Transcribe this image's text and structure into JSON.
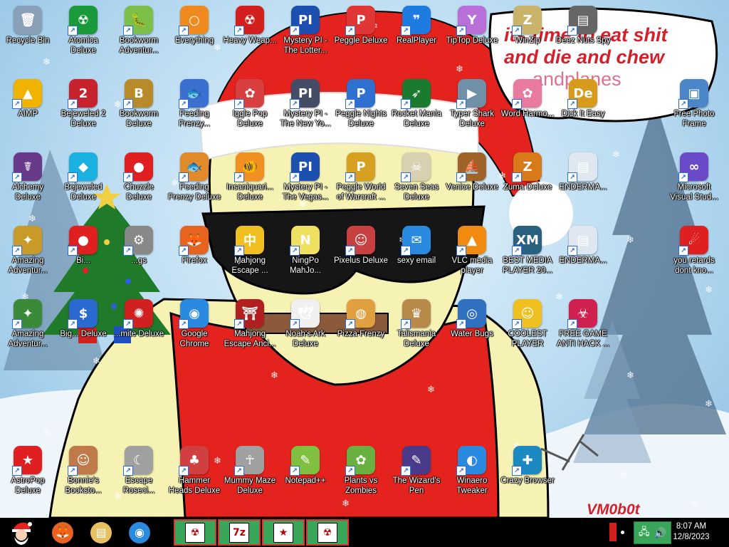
{
  "wallpaper": {
    "speech_bubble_line1": "its time to eat shit",
    "speech_bubble_line2": "and die and chew",
    "speech_bubble_line3": "andplanes",
    "signature": "VM0b0t"
  },
  "desktop_icons": [
    {
      "label": "Recycle Bin",
      "icon": "recycle-bin-icon",
      "color": "#8aa0b8",
      "g": "🗑",
      "col": 0,
      "row": 0
    },
    {
      "label": "Atomica Deluxe",
      "icon": "atomica-icon",
      "color": "#1a9a3a",
      "g": "☢",
      "col": 1,
      "row": 0
    },
    {
      "label": "Bookworm Adventur...",
      "icon": "bookworm-icon",
      "color": "#7cc04a",
      "g": "🐛",
      "col": 2,
      "row": 0
    },
    {
      "label": "Everything",
      "icon": "magnifier-icon",
      "color": "#f08a1e",
      "g": "○",
      "col": 3,
      "row": 0
    },
    {
      "label": "Heavy Weap...",
      "icon": "heavy-weapon-icon",
      "color": "#d41f1f",
      "g": "☢",
      "col": 4,
      "row": 0
    },
    {
      "label": "Mystery PI - The Lotter...",
      "icon": "mystery-pi-icon",
      "color": "#1d4fb0",
      "g": "PI",
      "col": 5,
      "row": 0
    },
    {
      "label": "Peggle Deluxe",
      "icon": "peggle-icon",
      "color": "#e03636",
      "g": "P",
      "col": 6,
      "row": 0
    },
    {
      "label": "RealPlayer",
      "icon": "realplayer-icon",
      "color": "#1e7be0",
      "g": "❞",
      "col": 7,
      "row": 0
    },
    {
      "label": "TipTop Deluxe",
      "icon": "tiptop-icon",
      "color": "#b870d8",
      "g": "Y",
      "col": 8,
      "row": 0
    },
    {
      "label": "WinZip",
      "icon": "winzip-icon",
      "color": "#c9b36a",
      "g": "Z",
      "col": 9,
      "row": 0
    },
    {
      "label": "Deez Nuts Spy",
      "icon": "deez-nuts-icon",
      "color": "#666666",
      "g": "▤",
      "col": 10,
      "row": 0
    },
    {
      "label": "AIMP",
      "icon": "aimp-icon",
      "color": "#f0b400",
      "g": "▲",
      "col": 0,
      "row": 1
    },
    {
      "label": "Bejeweled 2 Deluxe",
      "icon": "bejeweled2-icon",
      "color": "#c8232c",
      "g": "2",
      "col": 1,
      "row": 1
    },
    {
      "label": "Bookworm Deluxe",
      "icon": "bookworm-deluxe-icon",
      "color": "#b88a2a",
      "g": "B",
      "col": 2,
      "row": 1
    },
    {
      "label": "Feeding Frenzy...",
      "icon": "feeding-frenzy-icon",
      "color": "#3b6fd0",
      "g": "🐟",
      "col": 3,
      "row": 1
    },
    {
      "label": "Iggle Pop Deluxe",
      "icon": "iggle-pop-icon",
      "color": "#d84040",
      "g": "✿",
      "col": 4,
      "row": 1
    },
    {
      "label": "Mystery PI - The New Yo...",
      "icon": "mystery-pi-ny-icon",
      "color": "#444c66",
      "g": "PI",
      "col": 5,
      "row": 1
    },
    {
      "label": "Peggle Nights Deluxe",
      "icon": "peggle-nights-icon",
      "color": "#3070d0",
      "g": "P",
      "col": 6,
      "row": 1
    },
    {
      "label": "Rocket Mania Deluxe",
      "icon": "rocket-mania-icon",
      "color": "#1a7a2e",
      "g": "➶",
      "col": 7,
      "row": 1
    },
    {
      "label": "Typer Shark Deluxe",
      "icon": "typer-shark-icon",
      "color": "#7090a8",
      "g": "▶",
      "col": 8,
      "row": 1
    },
    {
      "label": "Word Harmo...",
      "icon": "word-harmony-icon",
      "color": "#e87aa0",
      "g": "✿",
      "col": 9,
      "row": 1
    },
    {
      "label": "Dick It Easy",
      "icon": "dick-it-easy-icon",
      "color": "#d89a1a",
      "g": "De",
      "col": 10,
      "row": 1
    },
    {
      "label": "Free Photo Frame",
      "icon": "photo-frame-icon",
      "color": "#4a86c8",
      "g": "▣",
      "col": 12,
      "row": 1
    },
    {
      "label": "Alchemy Deluxe",
      "icon": "alchemy-icon",
      "color": "#6a3a8a",
      "g": "☤",
      "col": 0,
      "row": 2
    },
    {
      "label": "Bejeweled Deluxe",
      "icon": "bejeweled-icon",
      "color": "#1ab0e0",
      "g": "◆",
      "col": 1,
      "row": 2
    },
    {
      "label": "Chuzzle Deluxe",
      "icon": "chuzzle-icon",
      "color": "#e02020",
      "g": "●",
      "col": 2,
      "row": 2
    },
    {
      "label": "Feeding Frenzy Deluxe",
      "icon": "feeding-frenzy-deluxe-icon",
      "color": "#e08a2a",
      "g": "🐟",
      "col": 3,
      "row": 2
    },
    {
      "label": "Insaniquari... Deluxe",
      "icon": "insaniquarium-icon",
      "color": "#f09020",
      "g": "🐠",
      "col": 4,
      "row": 2
    },
    {
      "label": "Mystery PI - The Vegas...",
      "icon": "mystery-pi-vegas-icon",
      "color": "#1d4fb0",
      "g": "PI",
      "col": 5,
      "row": 2
    },
    {
      "label": "Peggle World of Warcraft ...",
      "icon": "peggle-wow-icon",
      "color": "#d8a020",
      "g": "P",
      "col": 6,
      "row": 2
    },
    {
      "label": "Seven Seas Deluxe",
      "icon": "seven-seas-icon",
      "color": "#d8d0b0",
      "g": "☠",
      "col": 7,
      "row": 2
    },
    {
      "label": "Venice Deluxe",
      "icon": "venice-icon",
      "color": "#a0642a",
      "g": "⛵",
      "col": 8,
      "row": 2
    },
    {
      "label": "Zuma Deluxe",
      "icon": "zuma-icon",
      "color": "#d87a1a",
      "g": "Z",
      "col": 9,
      "row": 2
    },
    {
      "label": "ENDERMA...",
      "icon": "enderma-icon",
      "color": "#dfe8f0",
      "g": "▤",
      "col": 10,
      "row": 2
    },
    {
      "label": "Microsoft Visual Stud...",
      "icon": "visual-studio-icon",
      "color": "#6a4ac8",
      "g": "∞",
      "col": 12,
      "row": 2
    },
    {
      "label": "Amazing Adventur...",
      "icon": "amazing-adventures-icon",
      "color": "#c89a2a",
      "g": "✦",
      "col": 0,
      "row": 3
    },
    {
      "label": "Bi...",
      "icon": "partial-game-icon",
      "color": "#e02020",
      "g": "●",
      "col": 1,
      "row": 3
    },
    {
      "label": "...gs",
      "icon": "gears-icon",
      "color": "#888888",
      "g": "⚙",
      "col": 2,
      "row": 3
    },
    {
      "label": "Firefox",
      "icon": "firefox-icon",
      "color": "#e8641e",
      "g": "🦊",
      "col": 3,
      "row": 3
    },
    {
      "label": "Mahjong Escape ...",
      "icon": "mahjong-escape-icon",
      "color": "#f0c020",
      "g": "中",
      "col": 4,
      "row": 3
    },
    {
      "label": "NingPo MahJo...",
      "icon": "ningpo-icon",
      "color": "#f0e060",
      "g": "N",
      "col": 5,
      "row": 3
    },
    {
      "label": "Pixelus Deluxe",
      "icon": "pixelus-icon",
      "color": "#c84040",
      "g": "☺",
      "col": 6,
      "row": 3
    },
    {
      "label": "sexy email",
      "icon": "email-bird-icon",
      "color": "#2a8ae0",
      "g": "✉",
      "col": 7,
      "row": 3
    },
    {
      "label": "VLC media player",
      "icon": "vlc-icon",
      "color": "#f08a10",
      "g": "▲",
      "col": 8,
      "row": 3
    },
    {
      "label": "BEST MEDIA PLAYER 20...",
      "icon": "xmplay-icon",
      "color": "#2a6080",
      "g": "XM",
      "col": 9,
      "row": 3
    },
    {
      "label": "ENDERMA...",
      "icon": "enderma-2-icon",
      "color": "#dfe8f0",
      "g": "▤",
      "col": 10,
      "row": 3
    },
    {
      "label": "you retards dont kno...",
      "icon": "red-dragon-icon",
      "color": "#e02020",
      "g": "☄",
      "col": 12,
      "row": 3
    },
    {
      "label": "Amazing Adventur...",
      "icon": "amazing-adventures-2-icon",
      "color": "#3a8a3a",
      "g": "✦",
      "col": 0,
      "row": 4
    },
    {
      "label": "Big... Deluxe",
      "icon": "big-money-icon",
      "color": "#2a6ad0",
      "g": "$",
      "col": 1,
      "row": 4
    },
    {
      "label": "...mite Deluxe",
      "icon": "dynomite-icon",
      "color": "#d02020",
      "g": "✺",
      "col": 2,
      "row": 4
    },
    {
      "label": "Google Chrome",
      "icon": "chrome-icon",
      "color": "#2a8ae0",
      "g": "◉",
      "col": 3,
      "row": 4
    },
    {
      "label": "Mahjong Escape Anci...",
      "icon": "mahjong-ancient-icon",
      "color": "#b02020",
      "g": "⛩",
      "col": 4,
      "row": 4
    },
    {
      "label": "Noah's Ark Deluxe",
      "icon": "noahs-ark-icon",
      "color": "#f0f0f0",
      "g": "🕊",
      "col": 5,
      "row": 4
    },
    {
      "label": "Pizza Frenzy",
      "icon": "pizza-frenzy-icon",
      "color": "#e0a040",
      "g": "◍",
      "col": 6,
      "row": 4
    },
    {
      "label": "Talismania Deluxe",
      "icon": "talismania-icon",
      "color": "#b88a4a",
      "g": "♛",
      "col": 7,
      "row": 4
    },
    {
      "label": "Water Bugs",
      "icon": "water-bugs-icon",
      "color": "#3070c0",
      "g": "◎",
      "col": 8,
      "row": 4
    },
    {
      "label": "COOLEST PLAYER",
      "icon": "coolest-player-icon",
      "color": "#f0c020",
      "g": "☺",
      "col": 9,
      "row": 4
    },
    {
      "label": "FREE GAME ANTI HACK ...",
      "icon": "anti-hack-icon",
      "color": "#d02050",
      "g": "☣",
      "col": 10,
      "row": 4
    },
    {
      "label": "AstroPop Deluxe",
      "icon": "astropop-icon",
      "color": "#e02020",
      "g": "★",
      "col": 0,
      "row": 6
    },
    {
      "label": "Bonnie's Booksto...",
      "icon": "bonnies-bookstore-icon",
      "color": "#c07a4a",
      "g": "☺",
      "col": 1,
      "row": 6
    },
    {
      "label": "Escape Roseci...",
      "icon": "escape-rosecliff-icon",
      "color": "#a0a0a0",
      "g": "☾",
      "col": 2,
      "row": 6
    },
    {
      "label": "Hammer Heads Deluxe",
      "icon": "hammer-heads-icon",
      "color": "#d04040",
      "g": "♣",
      "col": 3,
      "row": 6
    },
    {
      "label": "Mummy Maze Deluxe",
      "icon": "mummy-maze-icon",
      "color": "#a0a0a0",
      "g": "☥",
      "col": 4,
      "row": 6
    },
    {
      "label": "Notepad++",
      "icon": "notepadpp-icon",
      "color": "#80c040",
      "g": "✎",
      "col": 5,
      "row": 6
    },
    {
      "label": "Plants vs Zombies",
      "icon": "plants-vs-zombies-icon",
      "color": "#6ab040",
      "g": "✿",
      "col": 6,
      "row": 6
    },
    {
      "label": "The Wizard's Pen",
      "icon": "wizards-pen-icon",
      "color": "#4a3a8a",
      "g": "✎",
      "col": 7,
      "row": 6
    },
    {
      "label": "Winaero Tweaker",
      "icon": "winaero-icon",
      "color": "#2a8ae0",
      "g": "◐",
      "col": 8,
      "row": 6
    },
    {
      "label": "Crazy Browser",
      "icon": "crazy-browser-icon",
      "color": "#1a8ac0",
      "g": "✚",
      "col": 9,
      "row": 6
    }
  ],
  "taskbar": {
    "start_icon": "santa-start-icon",
    "pinned": [
      {
        "label": "Firefox",
        "icon": "firefox-icon",
        "color": "#e8641e",
        "g": "🦊"
      },
      {
        "label": "File Explorer",
        "icon": "file-explorer-icon",
        "color": "#e8c060",
        "g": "▤"
      },
      {
        "label": "Google Chrome",
        "icon": "chrome-icon",
        "color": "#2a8ae0",
        "g": "◉"
      }
    ],
    "tasks": [
      {
        "label": "",
        "icon": "atomica-task-icon",
        "g": "☢"
      },
      {
        "label": "7z",
        "icon": "7zip-icon",
        "g": "7z"
      },
      {
        "label": "",
        "icon": "star-task-icon",
        "g": "★"
      },
      {
        "label": "",
        "icon": "atomica-task-2-icon",
        "g": "☢"
      }
    ],
    "clock_time": "8:07 AM",
    "clock_date": "12/8/2023"
  }
}
